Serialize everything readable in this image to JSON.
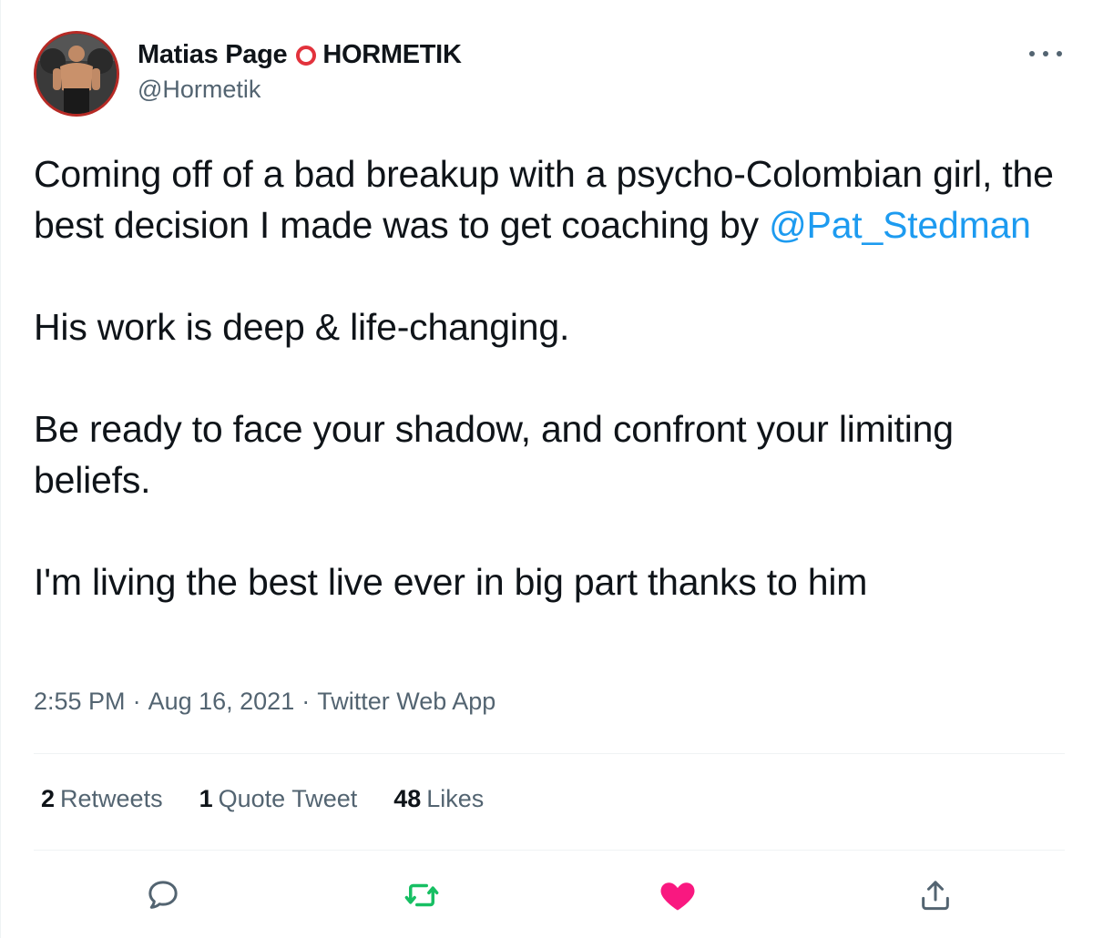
{
  "author": {
    "display_name": "Matias Page",
    "org_name": "HORMETIK",
    "handle": "@Hormetik"
  },
  "tweet": {
    "line1": "Coming off of a bad breakup with a psycho-Colombian girl, the best decision I made was to get coaching by ",
    "mention": "@Pat_Stedman",
    "para2": "His work is deep & life-changing.",
    "para3": "Be ready to face your shadow, and confront your limiting beliefs.",
    "para4": "I'm living the best live ever in big part thanks to him"
  },
  "meta": {
    "time": "2:55 PM",
    "date": "Aug 16, 2021",
    "source": "Twitter Web App",
    "separator": "·"
  },
  "stats": {
    "retweets_count": "2",
    "retweets_label": "Retweets",
    "quotes_count": "1",
    "quotes_label": "Quote Tweet",
    "likes_count": "48",
    "likes_label": "Likes"
  },
  "actions": {
    "reply_icon": "reply-icon",
    "retweet_icon": "retweet-icon",
    "like_icon": "heart-icon",
    "share_icon": "share-icon",
    "retweet_color": "#17bf63",
    "like_color": "#f91880",
    "muted_color": "#536471"
  },
  "colors": {
    "link": "#1d9bf0",
    "avatar_border": "#b62a25",
    "ring": "#e2323c"
  }
}
